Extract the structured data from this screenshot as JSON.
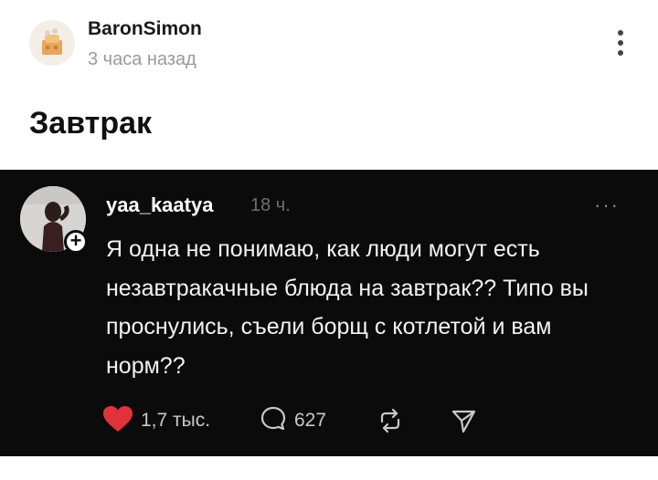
{
  "post": {
    "author": "BaronSimon",
    "time": "3 часа назад",
    "title": "Завтрак"
  },
  "comment": {
    "username": "yaa_kaatya",
    "time": "18 ч.",
    "more": "···",
    "text": "Я одна не понимаю, как люди могут есть незавтракачные блюда на завтрак?? Типо вы проснулись, съели борщ с котлетой и вам норм??",
    "follow_symbol": "+",
    "likes": "1,7 тыс.",
    "replies": "627"
  },
  "colors": {
    "embed_background": "#0b0b0b",
    "like_red": "#e3313b",
    "text_light": "#f2f2f2",
    "muted": "#9a9a9a"
  },
  "icons": [
    "kebab-menu-icon",
    "heart-icon",
    "comment-bubble-icon",
    "repost-icon",
    "share-icon",
    "plus-icon"
  ]
}
